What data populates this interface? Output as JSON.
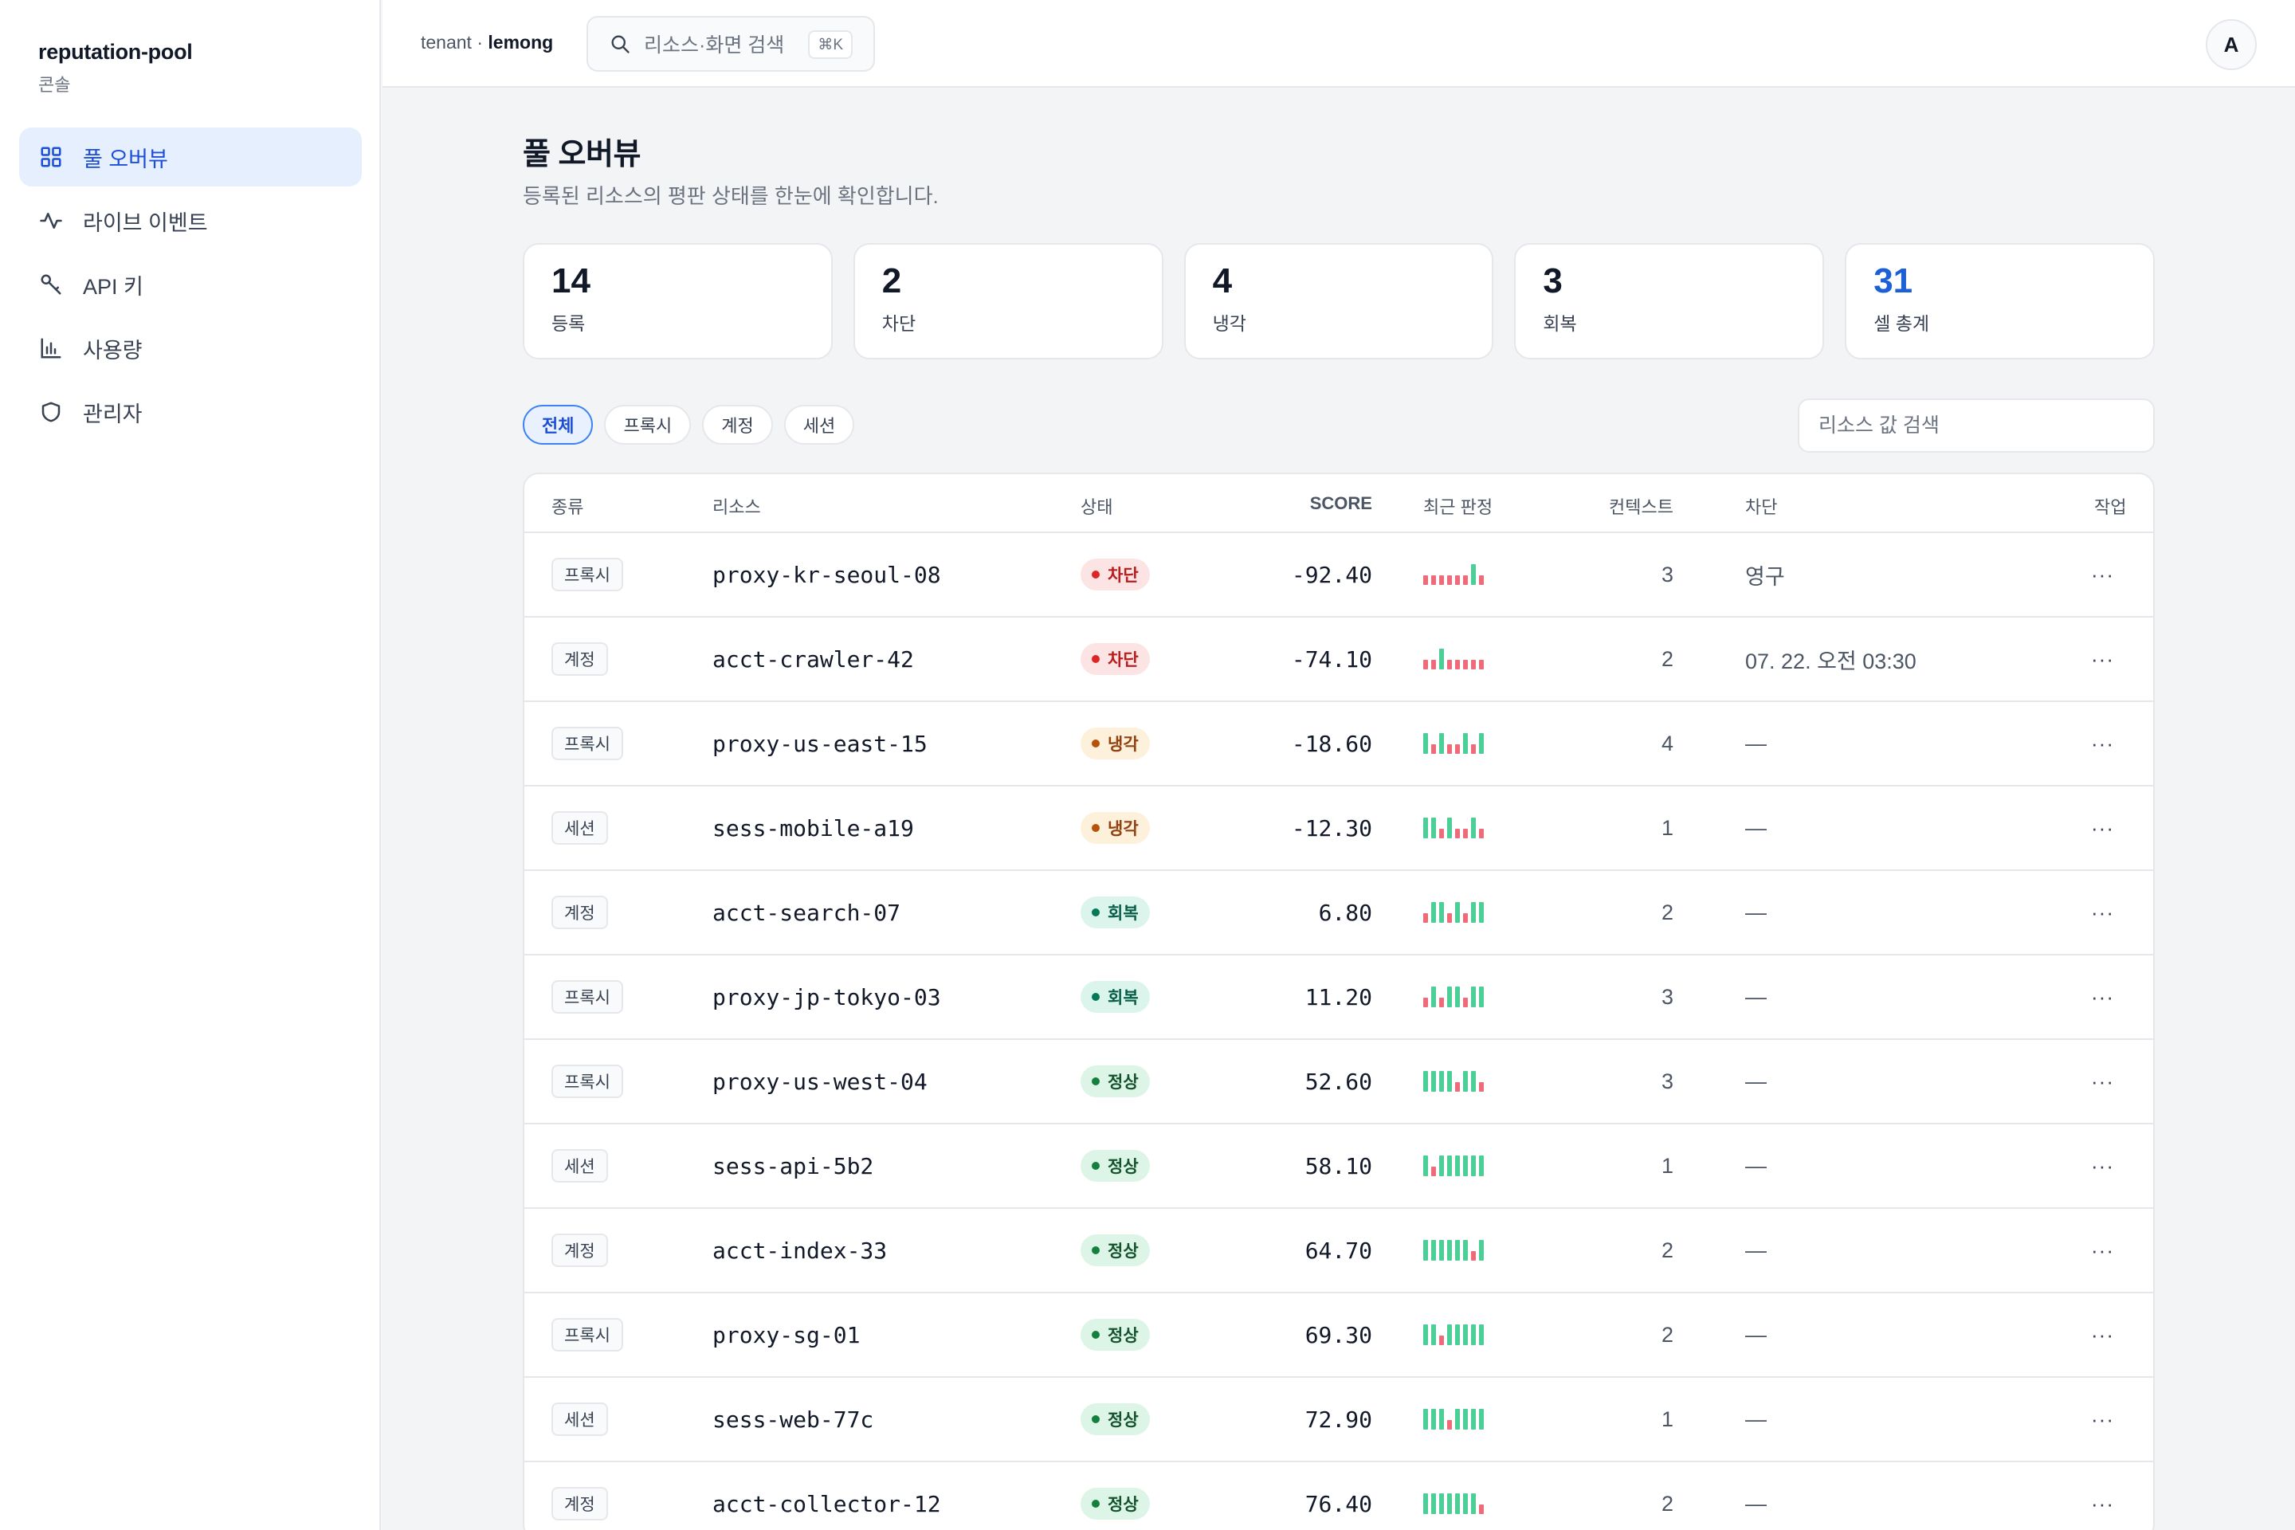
{
  "sidebar": {
    "brand_name": "reputation-pool",
    "brand_sub": "콘솔",
    "items": [
      {
        "label": "풀 오버뷰",
        "icon": "grid-icon"
      },
      {
        "label": "라이브 이벤트",
        "icon": "activity-icon"
      },
      {
        "label": "API 키",
        "icon": "key-icon"
      },
      {
        "label": "사용량",
        "icon": "bar-chart-icon"
      },
      {
        "label": "관리자",
        "icon": "shield-icon"
      }
    ]
  },
  "topbar": {
    "tenant_prefix": "tenant · ",
    "tenant_name": "lemong",
    "search_placeholder": "리소스·화면 검색",
    "search_shortcut": "⌘K",
    "avatar_initial": "A"
  },
  "main": {
    "title": "풀 오버뷰",
    "description": "등록된 리소스의 평판 상태를 한눈에 확인합니다.",
    "stats": [
      {
        "value": "14",
        "label": "등록"
      },
      {
        "value": "2",
        "label": "차단"
      },
      {
        "value": "4",
        "label": "냉각"
      },
      {
        "value": "3",
        "label": "회복"
      },
      {
        "value": "31",
        "label": "셀 총계"
      }
    ],
    "filters": [
      "전체",
      "프록시",
      "계정",
      "세션"
    ],
    "resource_search_placeholder": "리소스 값 검색",
    "table": {
      "headers": {
        "type": "종류",
        "resource": "리소스",
        "status": "상태",
        "score": "SCORE",
        "recent": "최근 판정",
        "contexts": "컨텍스트",
        "block": "차단",
        "actions": "작업"
      },
      "rows": [
        {
          "type": "프록시",
          "resource": "proxy-kr-seoul-08",
          "status": "차단",
          "status_kind": "blocked",
          "score": "-92.40",
          "recent": [
            0,
            0,
            0,
            0,
            0,
            0,
            1,
            0
          ],
          "contexts": "3",
          "block": "영구"
        },
        {
          "type": "계정",
          "resource": "acct-crawler-42",
          "status": "차단",
          "status_kind": "blocked",
          "score": "-74.10",
          "recent": [
            0,
            0,
            1,
            0,
            0,
            0,
            0,
            0
          ],
          "contexts": "2",
          "block": "07. 22. 오전 03:30"
        },
        {
          "type": "프록시",
          "resource": "proxy-us-east-15",
          "status": "냉각",
          "status_kind": "cooling",
          "score": "-18.60",
          "recent": [
            1,
            0,
            1,
            0,
            0,
            1,
            0,
            1
          ],
          "contexts": "4",
          "block": "—"
        },
        {
          "type": "세션",
          "resource": "sess-mobile-a19",
          "status": "냉각",
          "status_kind": "cooling",
          "score": "-12.30",
          "recent": [
            1,
            1,
            0,
            1,
            0,
            0,
            1,
            0
          ],
          "contexts": "1",
          "block": "—"
        },
        {
          "type": "계정",
          "resource": "acct-search-07",
          "status": "회복",
          "status_kind": "recovering",
          "score": "6.80",
          "recent": [
            0,
            1,
            1,
            0,
            1,
            0,
            1,
            1
          ],
          "contexts": "2",
          "block": "—"
        },
        {
          "type": "프록시",
          "resource": "proxy-jp-tokyo-03",
          "status": "회복",
          "status_kind": "recovering",
          "score": "11.20",
          "recent": [
            0,
            1,
            0,
            1,
            1,
            0,
            1,
            1
          ],
          "contexts": "3",
          "block": "—"
        },
        {
          "type": "프록시",
          "resource": "proxy-us-west-04",
          "status": "정상",
          "status_kind": "normal",
          "score": "52.60",
          "recent": [
            1,
            1,
            1,
            1,
            0,
            1,
            1,
            0
          ],
          "contexts": "3",
          "block": "—"
        },
        {
          "type": "세션",
          "resource": "sess-api-5b2",
          "status": "정상",
          "status_kind": "normal",
          "score": "58.10",
          "recent": [
            1,
            0,
            1,
            1,
            1,
            1,
            1,
            1
          ],
          "contexts": "1",
          "block": "—"
        },
        {
          "type": "계정",
          "resource": "acct-index-33",
          "status": "정상",
          "status_kind": "normal",
          "score": "64.70",
          "recent": [
            1,
            1,
            1,
            1,
            1,
            1,
            0,
            1
          ],
          "contexts": "2",
          "block": "—"
        },
        {
          "type": "프록시",
          "resource": "proxy-sg-01",
          "status": "정상",
          "status_kind": "normal",
          "score": "69.30",
          "recent": [
            1,
            1,
            0,
            1,
            1,
            1,
            1,
            1
          ],
          "contexts": "2",
          "block": "—"
        },
        {
          "type": "세션",
          "resource": "sess-web-77c",
          "status": "정상",
          "status_kind": "normal",
          "score": "72.90",
          "recent": [
            1,
            1,
            1,
            0,
            1,
            1,
            1,
            1
          ],
          "contexts": "1",
          "block": "—"
        },
        {
          "type": "계정",
          "resource": "acct-collector-12",
          "status": "정상",
          "status_kind": "normal",
          "score": "76.40",
          "recent": [
            1,
            1,
            1,
            1,
            1,
            1,
            1,
            0
          ],
          "contexts": "2",
          "block": "—"
        }
      ]
    }
  },
  "colors": {
    "accent": "#1d5fd6",
    "blocked_bg": "#fde4e4",
    "blocked_fg": "#b91c1c",
    "blocked_dot": "#dc2626",
    "cooling_bg": "#fdf1dc",
    "cooling_fg": "#92400e",
    "cooling_dot": "#b45309",
    "recovering_bg": "#dcf5ec",
    "recovering_fg": "#065f46",
    "recovering_dot": "#047857",
    "normal_bg": "#dcf5e6",
    "normal_fg": "#14532d",
    "normal_dot": "#15803d",
    "spark_pass": "#4ccf97",
    "spark_fail": "#ee6b7a"
  }
}
